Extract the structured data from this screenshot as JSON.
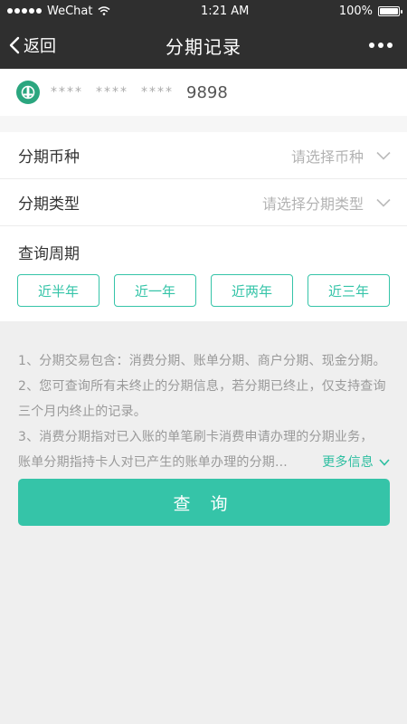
{
  "status_bar": {
    "carrier": "WeChat",
    "time": "1:21 AM",
    "battery": "100%",
    "battery_level": 1.0
  },
  "nav": {
    "back_label": "返回",
    "title": "分期记录"
  },
  "card": {
    "mask1": "****",
    "mask2": "****",
    "mask3": "****",
    "last_digits": "9898",
    "bank_color": "#2ba67f"
  },
  "form": {
    "currency_label": "分期币种",
    "currency_placeholder": "请选择币种",
    "type_label": "分期类型",
    "type_placeholder": "请选择分期类型",
    "period_label": "查询周期",
    "period_options": [
      "近半年",
      "近一年",
      "近两年",
      "近三年"
    ]
  },
  "notes": {
    "line1": "1、分期交易包含：消费分期、账单分期、商户分期、现金分期。",
    "line2": "2、您可查询所有未终止的分期信息，若分期已终止，仅支持查询三个月内终止的记录。",
    "line3": "3、消费分期指对已入账的单笔刷卡消费申请办理的分期业务，",
    "line4": "账单分期指持卡人对已产生的账单办理的分期...",
    "more_info": "更多信息"
  },
  "query_button": "查 询",
  "colors": {
    "accent": "#35c4a8",
    "header": "#2f2f2f"
  }
}
